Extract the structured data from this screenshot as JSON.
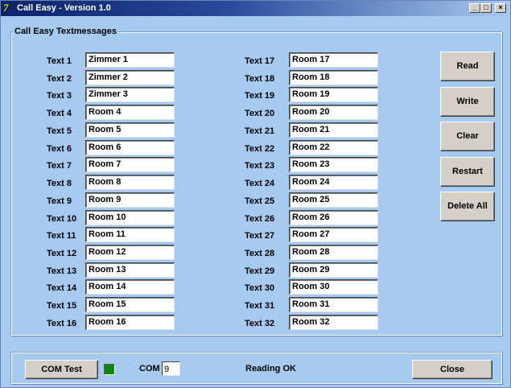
{
  "window": {
    "title": "Call Easy - Version 1.0",
    "icon": "7",
    "controls": {
      "minimize": "_",
      "maximize": "□",
      "close": "×"
    }
  },
  "group": {
    "legend": "Call Easy Textmessages"
  },
  "texts": [
    {
      "label": "Text 1",
      "value": "Zimmer 1"
    },
    {
      "label": "Text 2",
      "value": "Zimmer 2"
    },
    {
      "label": "Text 3",
      "value": "Zimmer 3"
    },
    {
      "label": "Text 4",
      "value": "Room 4"
    },
    {
      "label": "Text 5",
      "value": "Room 5"
    },
    {
      "label": "Text 6",
      "value": "Room 6"
    },
    {
      "label": "Text 7",
      "value": "Room 7"
    },
    {
      "label": "Text 8",
      "value": "Room 8"
    },
    {
      "label": "Text 9",
      "value": "Room 9"
    },
    {
      "label": "Text 10",
      "value": "Room 10"
    },
    {
      "label": "Text 11",
      "value": "Room 11"
    },
    {
      "label": "Text 12",
      "value": "Room 12"
    },
    {
      "label": "Text 13",
      "value": "Room 13"
    },
    {
      "label": "Text 14",
      "value": "Room 14"
    },
    {
      "label": "Text 15",
      "value": "Room 15"
    },
    {
      "label": "Text 16",
      "value": "Room 16"
    },
    {
      "label": "Text 17",
      "value": "Room 17"
    },
    {
      "label": "Text 18",
      "value": "Room 18"
    },
    {
      "label": "Text 19",
      "value": "Room 19"
    },
    {
      "label": "Text 20",
      "value": "Room 20"
    },
    {
      "label": "Text 21",
      "value": "Room 21"
    },
    {
      "label": "Text 22",
      "value": "Room 22"
    },
    {
      "label": "Text 23",
      "value": "Room 23"
    },
    {
      "label": "Text 24",
      "value": "Room 24"
    },
    {
      "label": "Text 25",
      "value": "Room 25"
    },
    {
      "label": "Text 26",
      "value": "Room 26"
    },
    {
      "label": "Text 27",
      "value": "Room 27"
    },
    {
      "label": "Text 28",
      "value": "Room 28"
    },
    {
      "label": "Text 29",
      "value": "Room 29"
    },
    {
      "label": "Text 30",
      "value": "Room 30"
    },
    {
      "label": "Text 31",
      "value": "Room 31"
    },
    {
      "label": "Text 32",
      "value": "Room 32"
    }
  ],
  "actions": {
    "read": "Read",
    "write": "Write",
    "clear": "Clear",
    "restart": "Restart",
    "delete_all": "Delete All"
  },
  "footer": {
    "com_test": "COM Test",
    "led_color": "#0a8a0a",
    "com_label": "COM",
    "com_value": "9",
    "status": "Reading OK",
    "close": "Close"
  }
}
